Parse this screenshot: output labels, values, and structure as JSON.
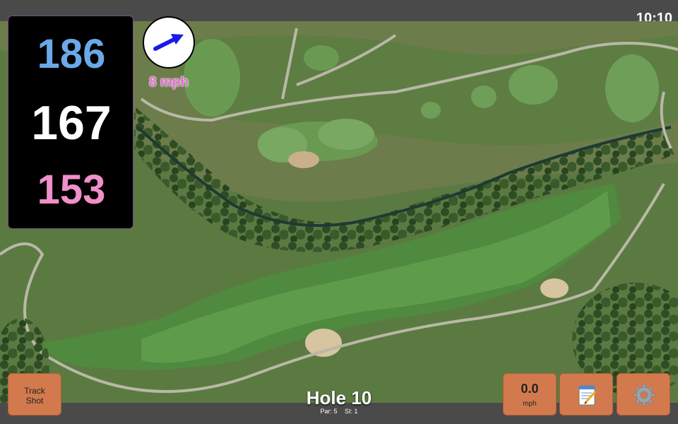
{
  "status_bar": {
    "time": "10:10"
  },
  "distances": {
    "back": "186",
    "middle": "167",
    "front": "153"
  },
  "wind": {
    "speed_label": "8 mph",
    "direction_icon": "arrow-up-right-icon",
    "arrow_color": "#1a1ae6"
  },
  "hole": {
    "title": "Hole 10",
    "par_label": "Par: 5",
    "si_label": "SI: 1"
  },
  "buttons": {
    "track_shot": {
      "line1": "Track",
      "line2": "Shot"
    },
    "speed": {
      "value": "0.0",
      "unit": "mph"
    },
    "notes": {
      "icon": "notepad-icon"
    },
    "settings": {
      "icon": "gear-icon"
    }
  },
  "colors": {
    "back_distance": "#6aa8e8",
    "middle_distance": "#ffffff",
    "front_distance": "#f08fc8",
    "wind_label": "#e56ad8",
    "button": "#d27a4e"
  }
}
